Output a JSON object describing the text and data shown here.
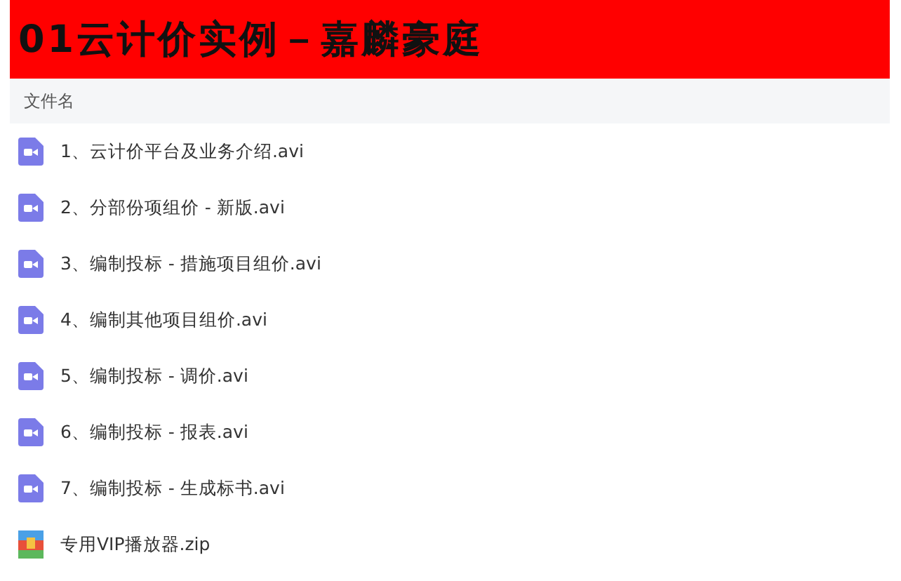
{
  "title": "**01**云计价实例－嘉麟豪庭",
  "table": {
    "columns": [
      "文件名"
    ],
    "rows": [
      {
        "kind": "video",
        "name": "1、云计价平台及业务介绍.avi"
      },
      {
        "kind": "video",
        "name": "2、分部份项组价 - 新版.avi"
      },
      {
        "kind": "video",
        "name": "3、编制投标 - 措施项目组价.avi"
      },
      {
        "kind": "video",
        "name": "4、编制其他项目组价.avi"
      },
      {
        "kind": "video",
        "name": "5、编制投标 - 调价.avi"
      },
      {
        "kind": "video",
        "name": "6、编制投标 - 报表.avi"
      },
      {
        "kind": "video",
        "name": "7、编制投标 - 生成标书.avi"
      },
      {
        "kind": "archive",
        "name": "专用VIP播放器.zip"
      }
    ]
  }
}
